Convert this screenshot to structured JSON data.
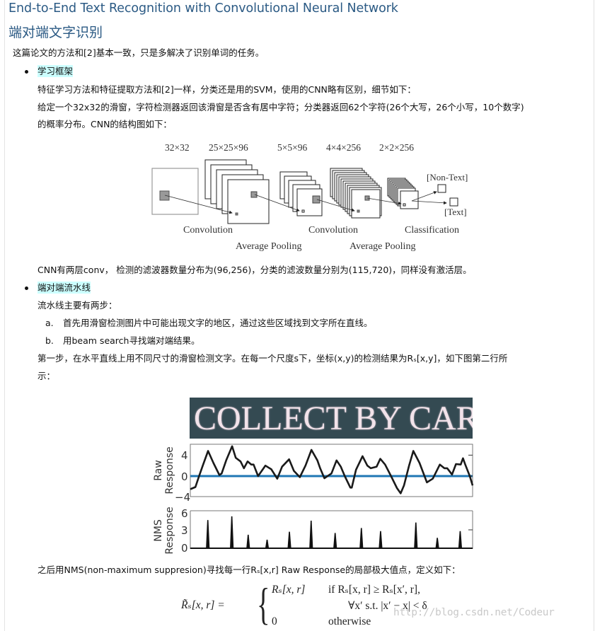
{
  "header": {
    "title_en": "End-to-End Text Recognition with Convolutional Neural Network",
    "title_zh": "端对端文字识别"
  },
  "intro": "这篇论文的方法和[2]基本一致，只是多解决了识别单词的任务。",
  "sections": [
    {
      "heading": "学习框架",
      "paragraphs": [
        "特征学习方法和特征提取方法和[2]一样，分类还是用的SVM，使用的CNN略有区别，细节如下：",
        "给定一个32x32的滑窗，字符检测器返回该滑窗是否含有居中字符；分类器返回62个字符(26个大写，26个小写，10个数字)",
        "的概率分布。CNN的结构图如下："
      ],
      "after_figure": "CNN有两层conv， 检测的滤波器数量分布为(96,256)，分类的滤波数量分别为(115,720)，同样没有激活层。"
    },
    {
      "heading": "端对端流水线",
      "paragraphs": [
        "流水线主要有两步："
      ],
      "steps": [
        {
          "marker": "a.",
          "text": "首先用滑窗检测图片中可能出现文字的地区，通过这些区域找到文字所在直线。"
        },
        {
          "marker": "b.",
          "text": "用beam search寻找端对端结果。"
        }
      ],
      "paragraph2_line1": "第一步，在水平直线上用不同尺寸的滑窗检测文字。在每一个尺度s下，坐标(x,y)的检测结果为Rₛ[x,y]，如下图第二行所",
      "paragraph2_line2": "示：",
      "after_figure": "之后用NMS(non-maximum suppresion)寻找每一行Rₛ[x,r] Raw Response的局部极大值点，定义如下："
    }
  ],
  "cnn_figure": {
    "dims": [
      "32×32",
      "25×25×96",
      "5×5×96",
      "4×4×256",
      "2×2×256"
    ],
    "stage_labels": [
      "Convolution",
      "Average Pooling",
      "Convolution",
      "Average Pooling",
      "Classification"
    ],
    "outputs": [
      "[Non-Text]",
      "[Text]"
    ]
  },
  "photo_text": "COLLECT BY CAR",
  "chart_data": [
    {
      "type": "line",
      "title": "",
      "ylabel": "Raw Response",
      "xlabel": "",
      "ylim": [
        -4,
        6
      ],
      "yticks": [
        "4",
        "0",
        "−4"
      ],
      "threshold": 0,
      "threshold_color": "#1f77b4",
      "x": [
        0,
        0.018,
        0.031,
        0.044,
        0.063,
        0.082,
        0.103,
        0.111,
        0.127,
        0.148,
        0.161,
        0.178,
        0.19,
        0.203,
        0.216,
        0.224,
        0.24,
        0.266,
        0.287,
        0.308,
        0.325,
        0.35,
        0.367,
        0.388,
        0.408,
        0.429,
        0.45,
        0.46,
        0.475,
        0.5,
        0.518,
        0.533,
        0.547,
        0.567,
        0.572,
        0.587,
        0.61,
        0.627,
        0.639,
        0.66,
        0.673,
        0.69,
        0.711,
        0.732,
        0.745,
        0.757,
        0.775,
        0.79,
        0.812,
        0.838,
        0.859,
        0.884,
        0.9,
        0.91,
        0.927,
        0.941,
        0.958,
        0.966,
        0.974,
        0.99,
        1.0
      ],
      "values": [
        -2.5,
        -2.1,
        0,
        2,
        4.8,
        2.5,
        0.2,
        0.5,
        3,
        5.7,
        3.5,
        2.8,
        1.5,
        2.8,
        2.2,
        2.2,
        0,
        2,
        1.3,
        -0.5,
        1.8,
        3.2,
        1,
        -0.2,
        2,
        5,
        3,
        1.5,
        -0.4,
        0.5,
        3,
        1.8,
        0,
        -2.2,
        -2.2,
        1.2,
        3.8,
        2,
        1.5,
        1.8,
        3.3,
        2.2,
        0,
        -2.3,
        -3.3,
        -1.8,
        2,
        4.8,
        2.5,
        -1.2,
        -0.5,
        2.2,
        1.5,
        1.5,
        0.3,
        2.3,
        2.2,
        3.4,
        2.2,
        0,
        -1.8
      ]
    },
    {
      "type": "bar",
      "title": "",
      "ylabel": "NMS Response",
      "xlabel": "",
      "ylim": [
        0,
        6
      ],
      "yticks": [
        "6",
        "3",
        "0"
      ],
      "peaks_x": [
        0.062,
        0.147,
        0.205,
        0.272,
        0.351,
        0.428,
        0.513,
        0.606,
        0.674,
        0.799,
        0.875,
        0.956
      ],
      "values": [
        4.6,
        5.2,
        2.2,
        1.4,
        2.7,
        4.5,
        2.5,
        3.3,
        2.8,
        4.2,
        1.7,
        2.8
      ]
    }
  ],
  "formula": {
    "lhs": "R̃ₛ[x, r] =",
    "case1_value": "Rₛ[x, r]",
    "case1_condition": "if Rₛ[x, r] ≥ Rₛ[x′, r],",
    "case1_condition2": "∀x′ s.t. |x′ − x| < δ",
    "case2_value": "0",
    "case2_condition": "otherwise"
  },
  "watermark": "http://blog.csdn.net/Codeur",
  "colors": {
    "title": "#2b5a84",
    "highlight": "#ccffff"
  }
}
